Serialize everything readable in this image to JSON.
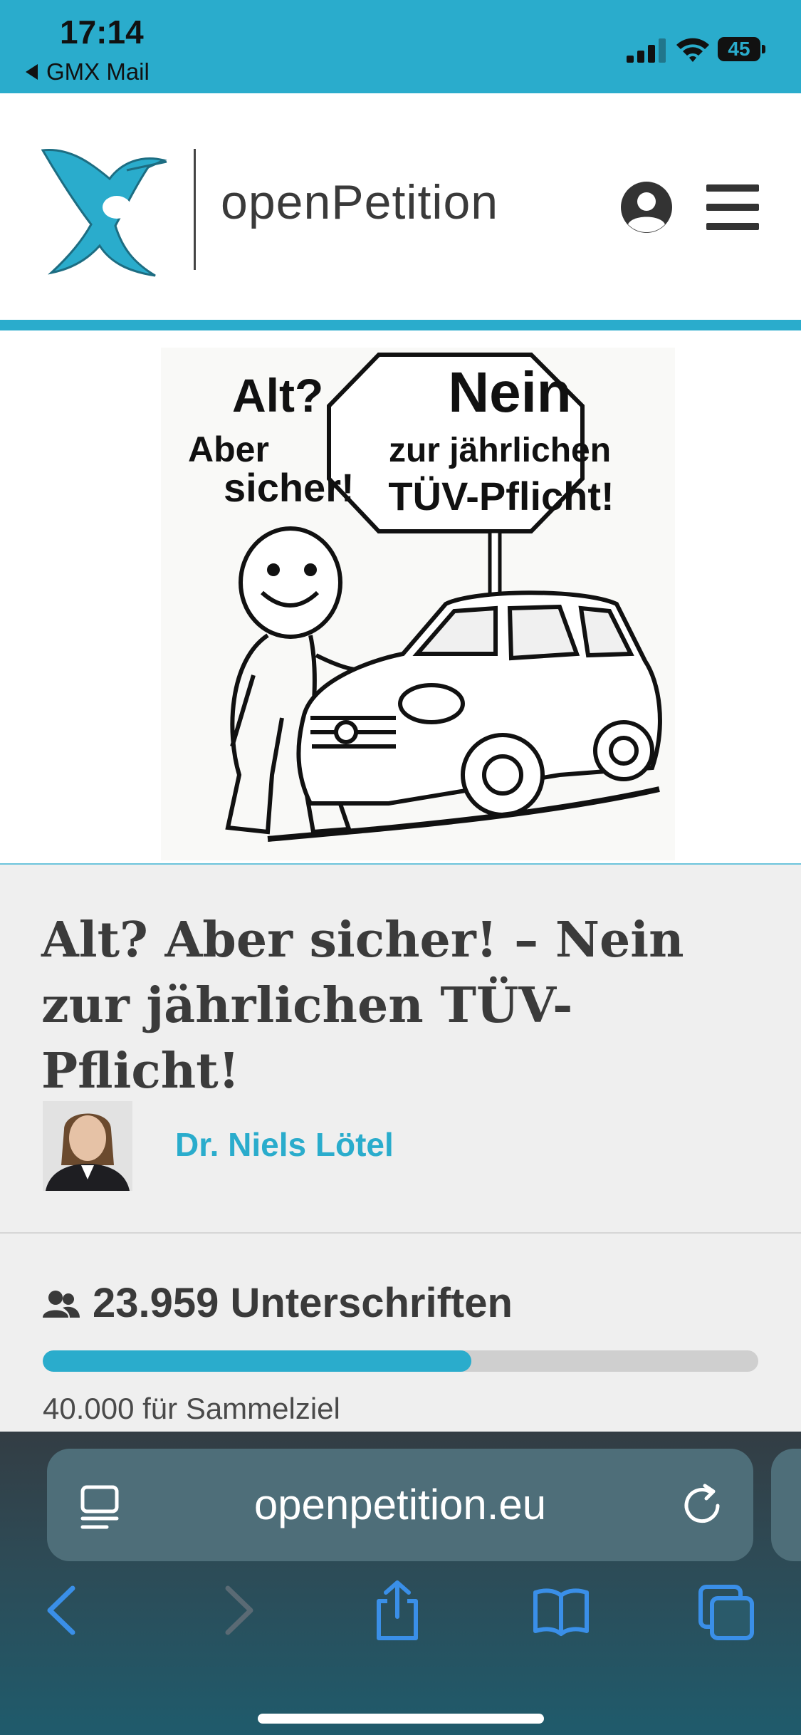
{
  "status_bar": {
    "time": "17:14",
    "back_app": "GMX Mail",
    "battery": "45"
  },
  "header": {
    "brand": "openPetition"
  },
  "hero": {
    "text_alt": "Alt?",
    "text_aber": "Aber",
    "text_sicher": "sicher!",
    "text_nein": "Nein",
    "text_zur": "zur jährlichen",
    "text_tuev": "TÜV-Pflicht!"
  },
  "petition": {
    "title": "Alt? Aber sicher! – Nein zur jährlichen TÜV-Pflicht!",
    "author": "Dr. Niels Lötel",
    "signatures": "23.959 Unterschriften",
    "signature_count": 23959,
    "goal_count": 40000,
    "progress_fraction": 0.599,
    "goal_label": "40.000 für Sammelziel"
  },
  "browser": {
    "url": "openpetition.eu"
  },
  "colors": {
    "accent": "#2aaccc",
    "content_bg": "#efefef",
    "toolbar_icon": "#3a8fe8"
  },
  "icons": [
    "signal-icon",
    "wifi-icon",
    "battery-icon",
    "logo-bird-icon",
    "account-icon",
    "menu-icon",
    "people-icon",
    "reader-icon",
    "reload-icon",
    "back-icon",
    "forward-icon",
    "share-icon",
    "bookmarks-icon",
    "tabs-icon"
  ]
}
